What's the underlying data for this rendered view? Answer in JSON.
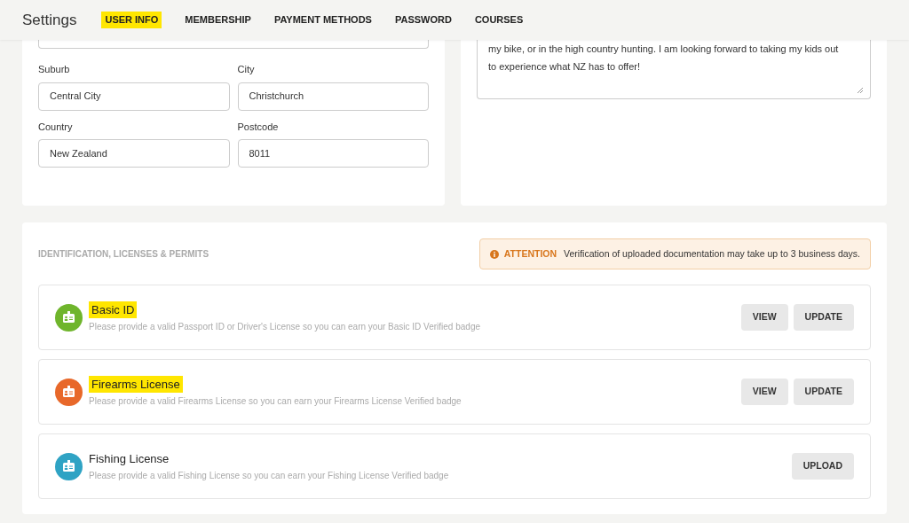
{
  "header": {
    "title": "Settings",
    "tabs": [
      {
        "label": "USER INFO",
        "selected": true
      },
      {
        "label": "MEMBERSHIP",
        "selected": false
      },
      {
        "label": "PAYMENT METHODS",
        "selected": false
      },
      {
        "label": "PASSWORD",
        "selected": false
      },
      {
        "label": "COURSES",
        "selected": false
      }
    ]
  },
  "address": {
    "fields": [
      {
        "label": "Suburb",
        "value": "Central City"
      },
      {
        "label": "City",
        "value": "Christchurch"
      },
      {
        "label": "Country",
        "value": "New Zealand"
      },
      {
        "label": "Postcode",
        "value": "8011"
      }
    ]
  },
  "bio": {
    "value": "my bike, or in the high country hunting. I am looking forward to taking my kids out to experience what NZ has to offer!"
  },
  "documents": {
    "title": "IDENTIFICATION, LICENSES & PERMITS",
    "notice": {
      "label": "ATTENTION",
      "text": "Verification of uploaded documentation may take up to 3 business days."
    },
    "items": [
      {
        "title": "Basic ID",
        "highlighted": true,
        "color": "#6fb52c",
        "description": "Please provide a valid Passport ID or Driver's License so you can earn your Basic ID Verified badge",
        "buttons": [
          "VIEW",
          "UPDATE"
        ]
      },
      {
        "title": "Firearms License",
        "highlighted": true,
        "color": "#e8682a",
        "description": "Please provide a valid Firearms License so you can earn your Firearms License Verified badge",
        "buttons": [
          "VIEW",
          "UPDATE"
        ]
      },
      {
        "title": "Fishing License",
        "highlighted": false,
        "color": "#2fa3c4",
        "description": "Please provide a valid Fishing License so you can earn your Fishing License Verified badge",
        "buttons": [
          "UPLOAD"
        ]
      }
    ]
  }
}
